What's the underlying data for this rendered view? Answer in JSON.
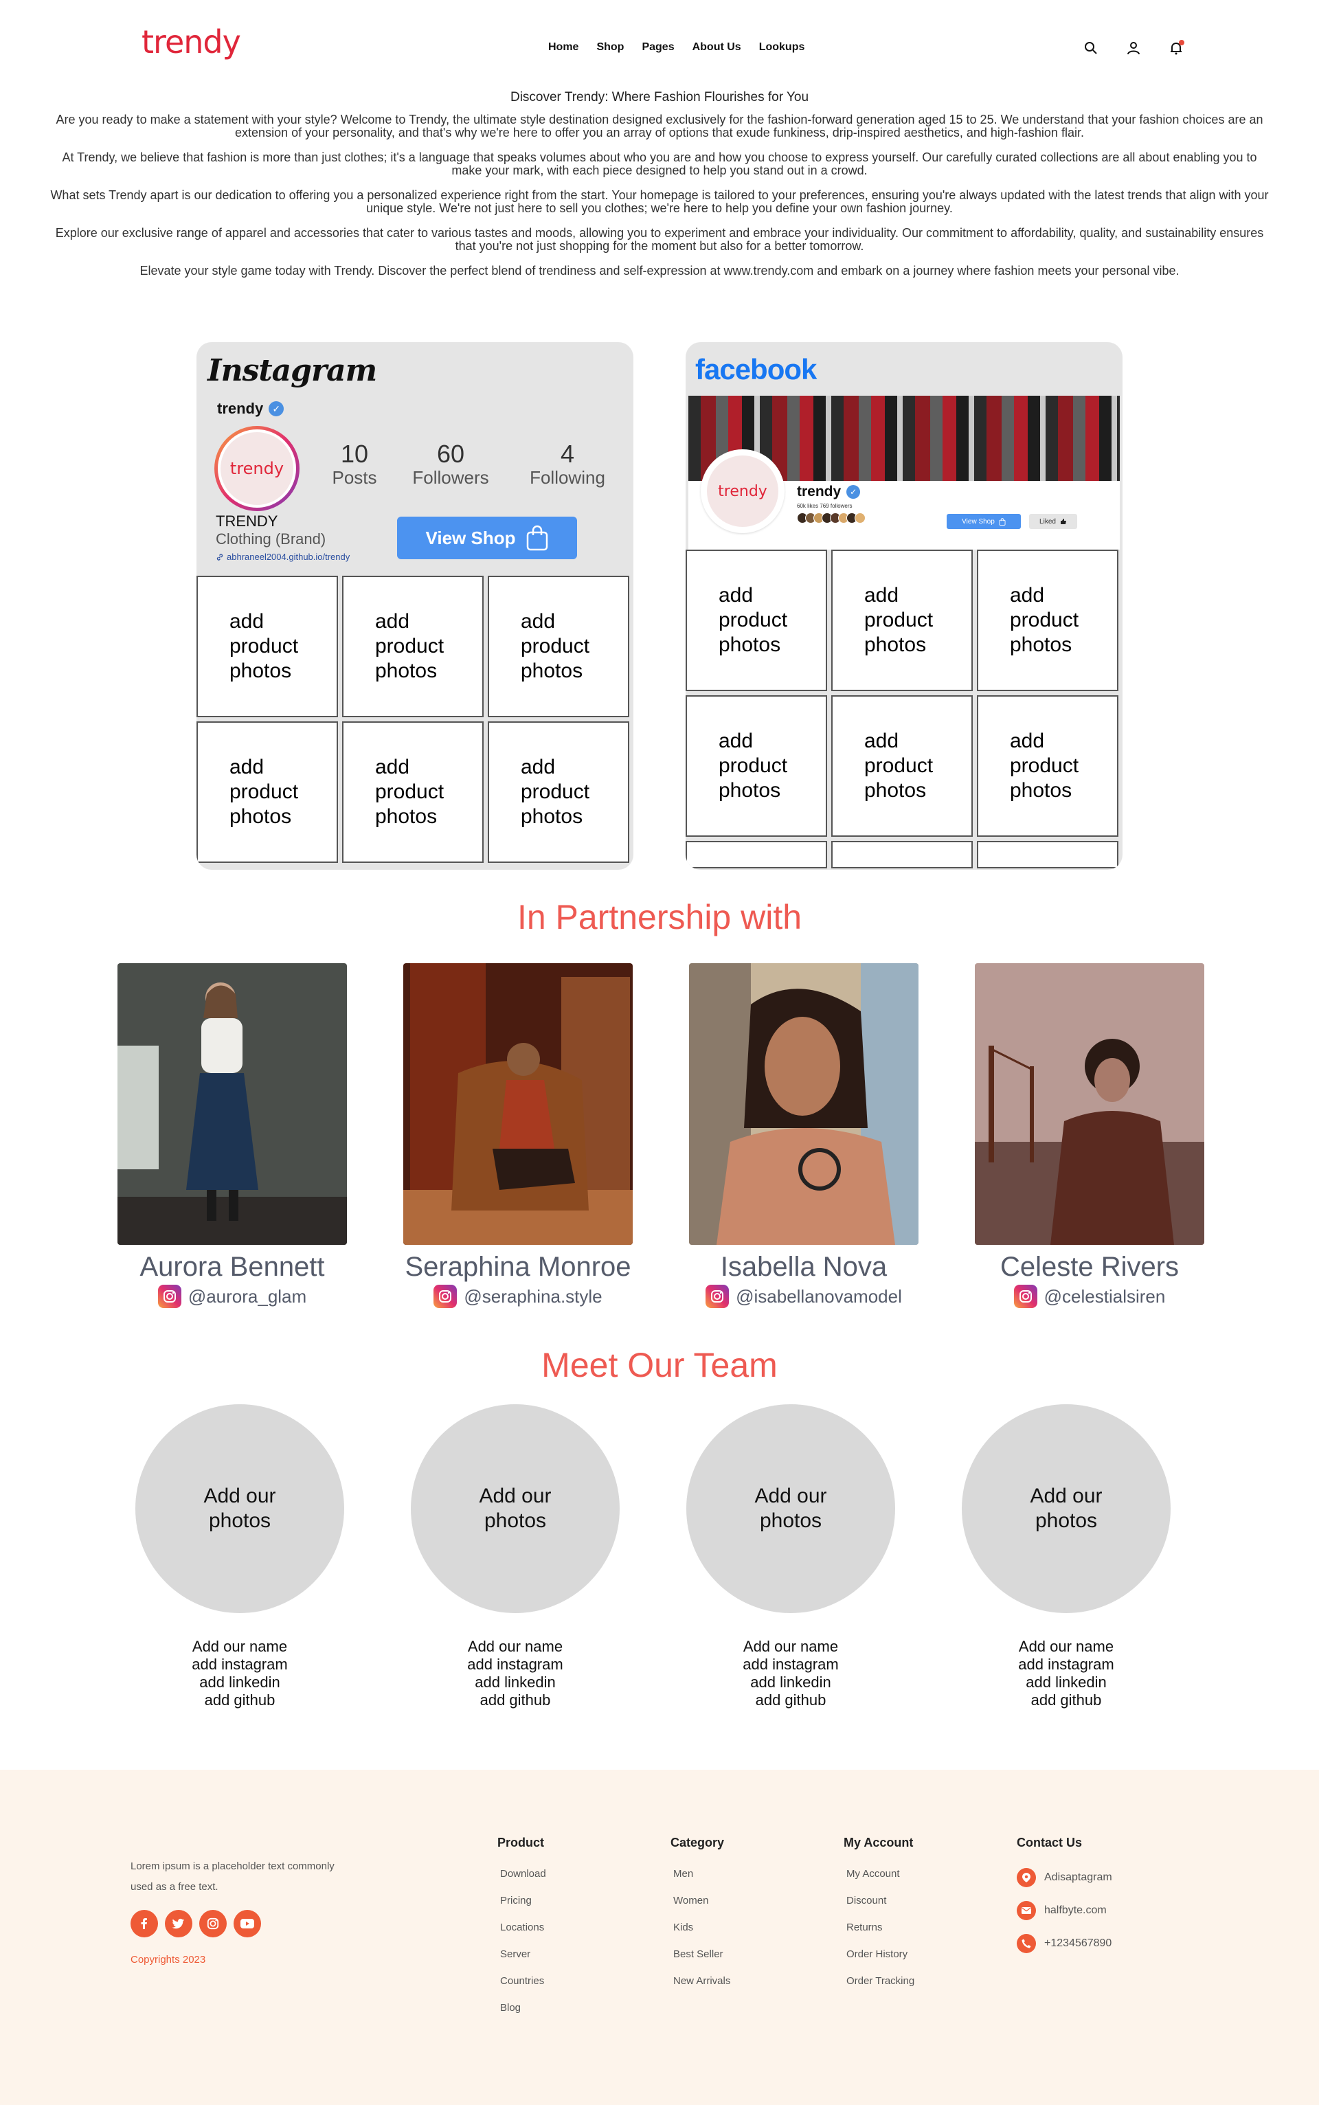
{
  "brand": {
    "logo": "trendy",
    "accent": "#e0263a",
    "heading_color": "#ee5a52"
  },
  "nav": {
    "items": [
      "Home",
      "Shop",
      "Pages",
      "About Us",
      "Lookups"
    ]
  },
  "header_icons": [
    "search-icon",
    "user-icon",
    "bell-icon"
  ],
  "intro": {
    "title": "Discover Trendy: Where Fashion Flourishes for You",
    "paragraphs": [
      "Are you ready to make a statement with your style? Welcome to Trendy, the ultimate style destination designed exclusively for the fashion-forward generation aged 15 to 25. We understand that your fashion choices are an extension of your personality, and that's why we're here to offer you an array of options that exude funkiness, drip-inspired aesthetics, and high-fashion flair.",
      "At Trendy, we believe that fashion is more than just clothes; it's a language that speaks volumes about who you are and how you choose to express yourself. Our carefully curated collections are all about enabling you to make your mark, with each piece designed to help you stand out in a crowd.",
      "What sets Trendy apart is our dedication to offering you a personalized experience right from the start. Your homepage is tailored to your preferences, ensuring you're always updated with the latest trends that align with your unique style. We're not just here to sell you clothes; we're here to help you define your own fashion journey.",
      "Explore our exclusive range of apparel and accessories that cater to various tastes and moods, allowing you to experiment and embrace your individuality. Our commitment to affordability, quality, and sustainability ensures that you're not just shopping for the moment but also for a better tomorrow.",
      "Elevate your style game today with Trendy. Discover the perfect blend of trendiness and self-expression at www.trendy.com and embark on a journey where fashion meets your personal vibe."
    ]
  },
  "instagram": {
    "title": "Instagram",
    "handle": "trendy",
    "avatar_text": "trendy",
    "stats": [
      {
        "num": "10",
        "label": "Posts"
      },
      {
        "num": "60",
        "label": "Followers"
      },
      {
        "num": "4",
        "label": "Following"
      }
    ],
    "name": "TRENDY",
    "category": "Clothing (Brand)",
    "link": "abhraneel2004.github.io/trendy",
    "button": "View Shop",
    "cells": [
      "add product photos",
      "add product photos",
      "add product photos",
      "add product photos",
      "add product photos",
      "add product photos"
    ]
  },
  "facebook": {
    "title": "facebook",
    "name": "trendy",
    "avatar_text": "trendy",
    "stats": "60k likes 769 followers",
    "view_shop": "View Shop",
    "liked": "Liked",
    "cells": [
      "add product photos",
      "add product photos",
      "add product photos",
      "add product photos",
      "add product photos",
      "add product photos"
    ]
  },
  "partners": {
    "title": "In Partnership with",
    "items": [
      {
        "name": "Aurora Bennett",
        "handle": "@aurora_glam"
      },
      {
        "name": "Seraphina Monroe",
        "handle": "@seraphina.style"
      },
      {
        "name": "Isabella Nova",
        "handle": "@isabellanovamodel"
      },
      {
        "name": "Celeste Rivers",
        "handle": "@celestialsiren"
      }
    ]
  },
  "team": {
    "title": "Meet Our Team",
    "members": [
      {
        "photo": "Add our photos",
        "name": "Add our name",
        "instagram": "add instagram",
        "linkedin": "add linkedin",
        "github": "add github"
      },
      {
        "photo": "Add our photos",
        "name": "Add our name",
        "instagram": "add instagram",
        "linkedin": "add linkedin",
        "github": "add github"
      },
      {
        "photo": "Add our photos",
        "name": "Add our name",
        "instagram": "add instagram",
        "linkedin": "add linkedin",
        "github": "add github"
      },
      {
        "photo": "Add our photos",
        "name": "Add our name",
        "instagram": "add instagram",
        "linkedin": "add linkedin",
        "github": "add github"
      }
    ]
  },
  "footer": {
    "about": "Lorem ipsum is a placeholder text commonly used as a free text.",
    "copyright": "Copyrights 2023",
    "socials": [
      "facebook-icon",
      "twitter-icon",
      "instagram-icon",
      "youtube-icon"
    ],
    "columns": [
      {
        "title": "Product",
        "links": [
          "Download",
          "Pricing",
          "Locations",
          "Server",
          "Countries",
          "Blog"
        ]
      },
      {
        "title": "Category",
        "links": [
          "Men",
          "Women",
          "Kids",
          "Best Seller",
          "New Arrivals"
        ]
      },
      {
        "title": "My Account",
        "links": [
          "My Account",
          "Discount",
          "Returns",
          "Order History",
          "Order Tracking"
        ]
      }
    ],
    "contact": {
      "title": "Contact Us",
      "address": "Adisaptagram",
      "email": "halfbyte.com",
      "phone": "+1234567890"
    }
  }
}
